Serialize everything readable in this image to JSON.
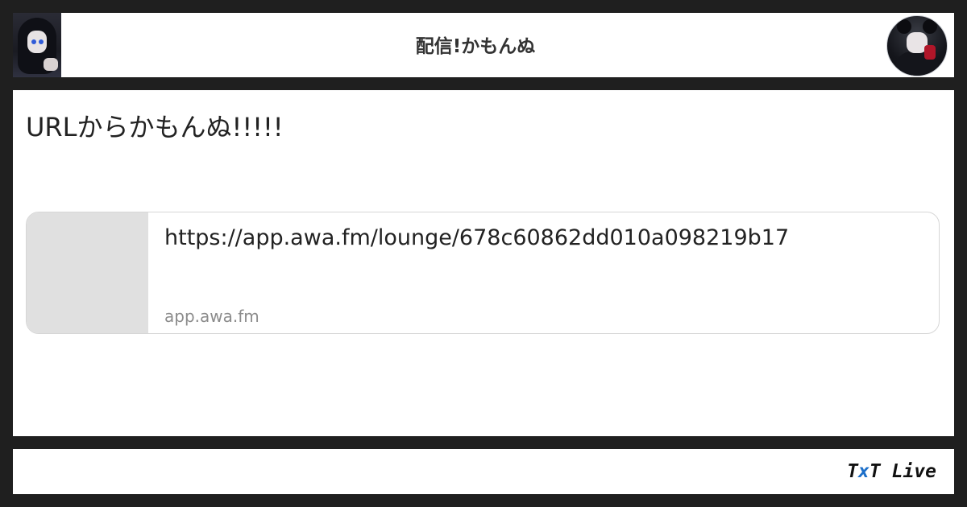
{
  "header": {
    "title": "配信!かもんぬ",
    "left_image_icon": "account-thumbnail",
    "avatar_icon": "user-avatar"
  },
  "post": {
    "text": "URLからかもんぬ!!!!!"
  },
  "link_card": {
    "url": "https://app.awa.fm/lounge/678c60862dd010a098219b17",
    "domain": "app.awa.fm"
  },
  "footer": {
    "brand_t1": "T",
    "brand_x": "x",
    "brand_t2": "T",
    "brand_live": " Live"
  },
  "colors": {
    "frame": "#1f1f1f",
    "panel": "#ffffff",
    "card_thumb": "#e0e0e0",
    "domain_text": "#8c8c8c",
    "brand_accent": "#1c6fc9"
  }
}
